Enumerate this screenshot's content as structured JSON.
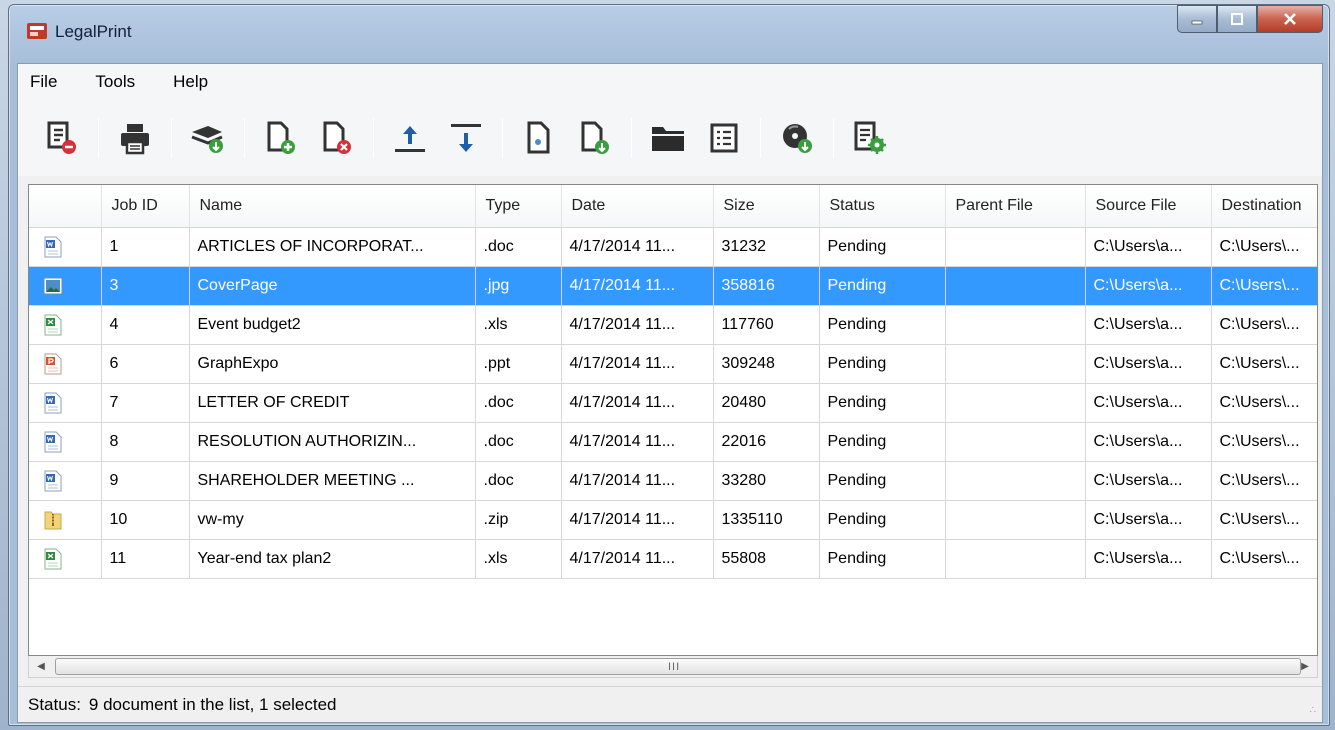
{
  "window": {
    "title": "LegalPrint"
  },
  "menu": {
    "file": "File",
    "tools": "Tools",
    "help": "Help"
  },
  "toolbar": {
    "buttons": [
      "remove-job-icon",
      "print-icon",
      "print-all-icon",
      "add-file-icon",
      "delete-file-icon",
      "move-up-icon",
      "move-down-icon",
      "new-document-icon",
      "add-document-icon",
      "open-folder-icon",
      "list-view-icon",
      "burn-disc-icon",
      "settings-icon"
    ]
  },
  "grid": {
    "columns": [
      "",
      "Job ID",
      "Name",
      "Type",
      "Date",
      "Size",
      "Status",
      "Parent File",
      "Source File",
      "Destination"
    ],
    "rows": [
      {
        "icon": "word",
        "job": "1",
        "name": "ARTICLES OF INCORPORAT...",
        "type": ".doc",
        "date": "4/17/2014 11...",
        "size": "31232",
        "status": "Pending",
        "parent": "",
        "source": "C:\\Users\\a...",
        "dest": "C:\\Users\\..."
      },
      {
        "icon": "image",
        "job": "3",
        "name": "CoverPage",
        "type": ".jpg",
        "date": "4/17/2014 11...",
        "size": "358816",
        "status": "Pending",
        "parent": "",
        "source": "C:\\Users\\a...",
        "dest": "C:\\Users\\..."
      },
      {
        "icon": "excel",
        "job": "4",
        "name": "Event budget2",
        "type": ".xls",
        "date": "4/17/2014 11...",
        "size": "117760",
        "status": "Pending",
        "parent": "",
        "source": "C:\\Users\\a...",
        "dest": "C:\\Users\\..."
      },
      {
        "icon": "ppt",
        "job": "6",
        "name": "GraphExpo",
        "type": ".ppt",
        "date": "4/17/2014 11...",
        "size": "309248",
        "status": "Pending",
        "parent": "",
        "source": "C:\\Users\\a...",
        "dest": "C:\\Users\\..."
      },
      {
        "icon": "word",
        "job": "7",
        "name": "LETTER OF CREDIT",
        "type": ".doc",
        "date": "4/17/2014 11...",
        "size": "20480",
        "status": "Pending",
        "parent": "",
        "source": "C:\\Users\\a...",
        "dest": "C:\\Users\\..."
      },
      {
        "icon": "word",
        "job": "8",
        "name": "RESOLUTION AUTHORIZIN...",
        "type": ".doc",
        "date": "4/17/2014 11...",
        "size": "22016",
        "status": "Pending",
        "parent": "",
        "source": "C:\\Users\\a...",
        "dest": "C:\\Users\\..."
      },
      {
        "icon": "word",
        "job": "9",
        "name": "SHAREHOLDER MEETING ...",
        "type": ".doc",
        "date": "4/17/2014 11...",
        "size": "33280",
        "status": "Pending",
        "parent": "",
        "source": "C:\\Users\\a...",
        "dest": "C:\\Users\\..."
      },
      {
        "icon": "zip",
        "job": "10",
        "name": "vw-my",
        "type": ".zip",
        "date": "4/17/2014 11...",
        "size": "1335110",
        "status": "Pending",
        "parent": "",
        "source": "C:\\Users\\a...",
        "dest": "C:\\Users\\..."
      },
      {
        "icon": "excel",
        "job": "11",
        "name": "Year-end tax plan2",
        "type": ".xls",
        "date": "4/17/2014 11...",
        "size": "55808",
        "status": "Pending",
        "parent": "",
        "source": "C:\\Users\\a...",
        "dest": "C:\\Users\\..."
      }
    ],
    "selected_row": 1
  },
  "scrollbar": {
    "grip": "III"
  },
  "status": {
    "label": "Status:",
    "text": "9 document in the list, 1 selected"
  },
  "colors": {
    "selection": "#3399ff",
    "title_bg": "#a7bed9"
  }
}
